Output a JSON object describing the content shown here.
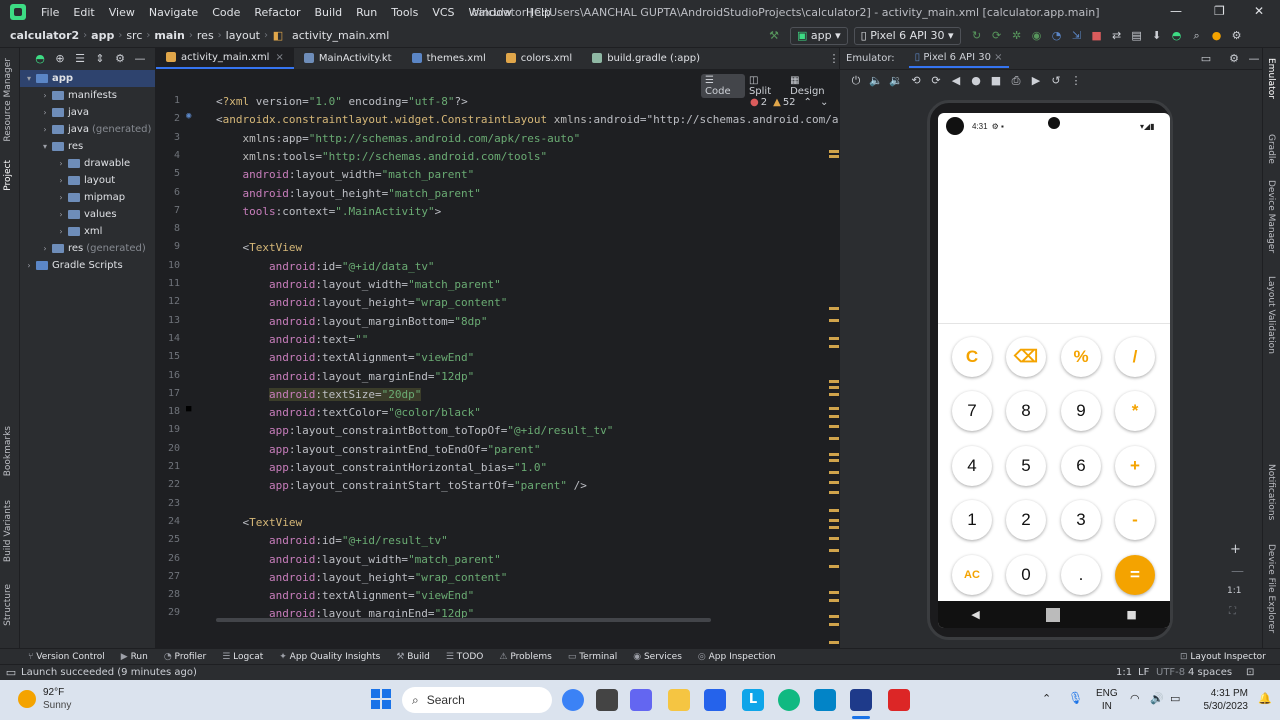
{
  "titlebar": {
    "menus": [
      "File",
      "Edit",
      "View",
      "Navigate",
      "Code",
      "Refactor",
      "Build",
      "Run",
      "Tools",
      "VCS",
      "Window",
      "Help"
    ],
    "title": "calculator [C:\\Users\\AANCHAL GUPTA\\AndroidStudioProjects\\calculator2] - activity_main.xml [calculator.app.main]"
  },
  "navbar": {
    "breadcrumbs": [
      "calculator2",
      "app",
      "src",
      "main",
      "res",
      "layout",
      "activity_main.xml"
    ],
    "run_config": "app",
    "device": "Pixel 6 API 30"
  },
  "project_panel": {
    "items": [
      {
        "label": "app",
        "depth": 0,
        "expanded": true,
        "suffix": ""
      },
      {
        "label": "manifests",
        "depth": 1,
        "expanded": false,
        "suffix": ""
      },
      {
        "label": "java",
        "depth": 1,
        "expanded": false,
        "suffix": ""
      },
      {
        "label": "java",
        "depth": 1,
        "expanded": false,
        "suffix": "(generated)"
      },
      {
        "label": "res",
        "depth": 1,
        "expanded": true,
        "suffix": ""
      },
      {
        "label": "drawable",
        "depth": 2,
        "expanded": false,
        "suffix": ""
      },
      {
        "label": "layout",
        "depth": 2,
        "expanded": false,
        "suffix": ""
      },
      {
        "label": "mipmap",
        "depth": 2,
        "expanded": false,
        "suffix": ""
      },
      {
        "label": "values",
        "depth": 2,
        "expanded": false,
        "suffix": ""
      },
      {
        "label": "xml",
        "depth": 2,
        "expanded": false,
        "suffix": ""
      },
      {
        "label": "res",
        "depth": 1,
        "expanded": false,
        "suffix": "(generated)"
      },
      {
        "label": "Gradle Scripts",
        "depth": 0,
        "expanded": false,
        "suffix": ""
      }
    ]
  },
  "left_strip": [
    "Resource Manager",
    "Project",
    "Bookmarks",
    "Build Variants",
    "Structure"
  ],
  "right_strip": [
    "Emulator",
    "Gradle",
    "Device Manager",
    "Layout Validation",
    "Notifications",
    "Device File Explorer"
  ],
  "editor": {
    "tabs": [
      "activity_main.xml",
      "MainActivity.kt",
      "themes.xml",
      "colors.xml",
      "build.gradle (:app)"
    ],
    "view_modes": [
      "Code",
      "Split",
      "Design"
    ],
    "errors": "2",
    "warnings": "52",
    "lines": [
      {
        "n": "1",
        "t": "<?xml version=\"1.0\" encoding=\"utf-8\"?>"
      },
      {
        "n": "2",
        "t": "<androidx.constraintlayout.widget.ConstraintLayout xmlns:android=\"http://schemas.android.com/a"
      },
      {
        "n": "3",
        "t": "    xmlns:app=\"http://schemas.android.com/apk/res-auto\""
      },
      {
        "n": "4",
        "t": "    xmlns:tools=\"http://schemas.android.com/tools\""
      },
      {
        "n": "5",
        "t": "    android:layout_width=\"match_parent\""
      },
      {
        "n": "6",
        "t": "    android:layout_height=\"match_parent\""
      },
      {
        "n": "7",
        "t": "    tools:context=\".MainActivity\">"
      },
      {
        "n": "8",
        "t": ""
      },
      {
        "n": "9",
        "t": "    <TextView"
      },
      {
        "n": "10",
        "t": "        android:id=\"@+id/data_tv\""
      },
      {
        "n": "11",
        "t": "        android:layout_width=\"match_parent\""
      },
      {
        "n": "12",
        "t": "        android:layout_height=\"wrap_content\""
      },
      {
        "n": "13",
        "t": "        android:layout_marginBottom=\"8dp\""
      },
      {
        "n": "14",
        "t": "        android:text=\"\""
      },
      {
        "n": "15",
        "t": "        android:textAlignment=\"viewEnd\""
      },
      {
        "n": "16",
        "t": "        android:layout_marginEnd=\"12dp\""
      },
      {
        "n": "17",
        "t": "        android:textSize=\"20dp\""
      },
      {
        "n": "18",
        "t": "        android:textColor=\"@color/black\""
      },
      {
        "n": "19",
        "t": "        app:layout_constraintBottom_toTopOf=\"@+id/result_tv\""
      },
      {
        "n": "20",
        "t": "        app:layout_constraintEnd_toEndOf=\"parent\""
      },
      {
        "n": "21",
        "t": "        app:layout_constraintHorizontal_bias=\"1.0\""
      },
      {
        "n": "22",
        "t": "        app:layout_constraintStart_toStartOf=\"parent\" />"
      },
      {
        "n": "23",
        "t": ""
      },
      {
        "n": "24",
        "t": "    <TextView"
      },
      {
        "n": "25",
        "t": "        android:id=\"@+id/result_tv\""
      },
      {
        "n": "26",
        "t": "        android:layout_width=\"match_parent\""
      },
      {
        "n": "27",
        "t": "        android:layout_height=\"wrap_content\""
      },
      {
        "n": "28",
        "t": "        android:textAlignment=\"viewEnd\""
      },
      {
        "n": "29",
        "t": "        android:layout_marginEnd=\"12dp\""
      }
    ]
  },
  "emulator": {
    "label": "Emulator:",
    "tab": "Pixel 6 API 30",
    "status_time": "4:31",
    "keys": [
      [
        "C",
        "⌫",
        "%",
        "/"
      ],
      [
        "7",
        "8",
        "9",
        "*"
      ],
      [
        "4",
        "5",
        "6",
        "+"
      ],
      [
        "1",
        "2",
        "3",
        "-"
      ],
      [
        "AC",
        "0",
        ".",
        "="
      ]
    ],
    "zoom": "1:1"
  },
  "bottom_tools": [
    "Version Control",
    "Run",
    "Profiler",
    "Logcat",
    "App Quality Insights",
    "Build",
    "TODO",
    "Problems",
    "Terminal",
    "Services",
    "App Inspection",
    "Layout Inspector"
  ],
  "status": {
    "message": "Launch succeeded (9 minutes ago)",
    "position": "1:1",
    "line_sep": "LF",
    "encoding": "UTF-8",
    "indent": "4 spaces"
  },
  "taskbar": {
    "weather_temp": "92°F",
    "weather_desc": "Sunny",
    "search": "Search",
    "lang1": "ENG",
    "lang2": "IN",
    "time": "4:31 PM",
    "date": "5/30/2023"
  },
  "colors": {
    "accent": "#3574f0",
    "calc_orange": "#f4a300",
    "tag": "#d5b778",
    "value": "#6aab73"
  }
}
